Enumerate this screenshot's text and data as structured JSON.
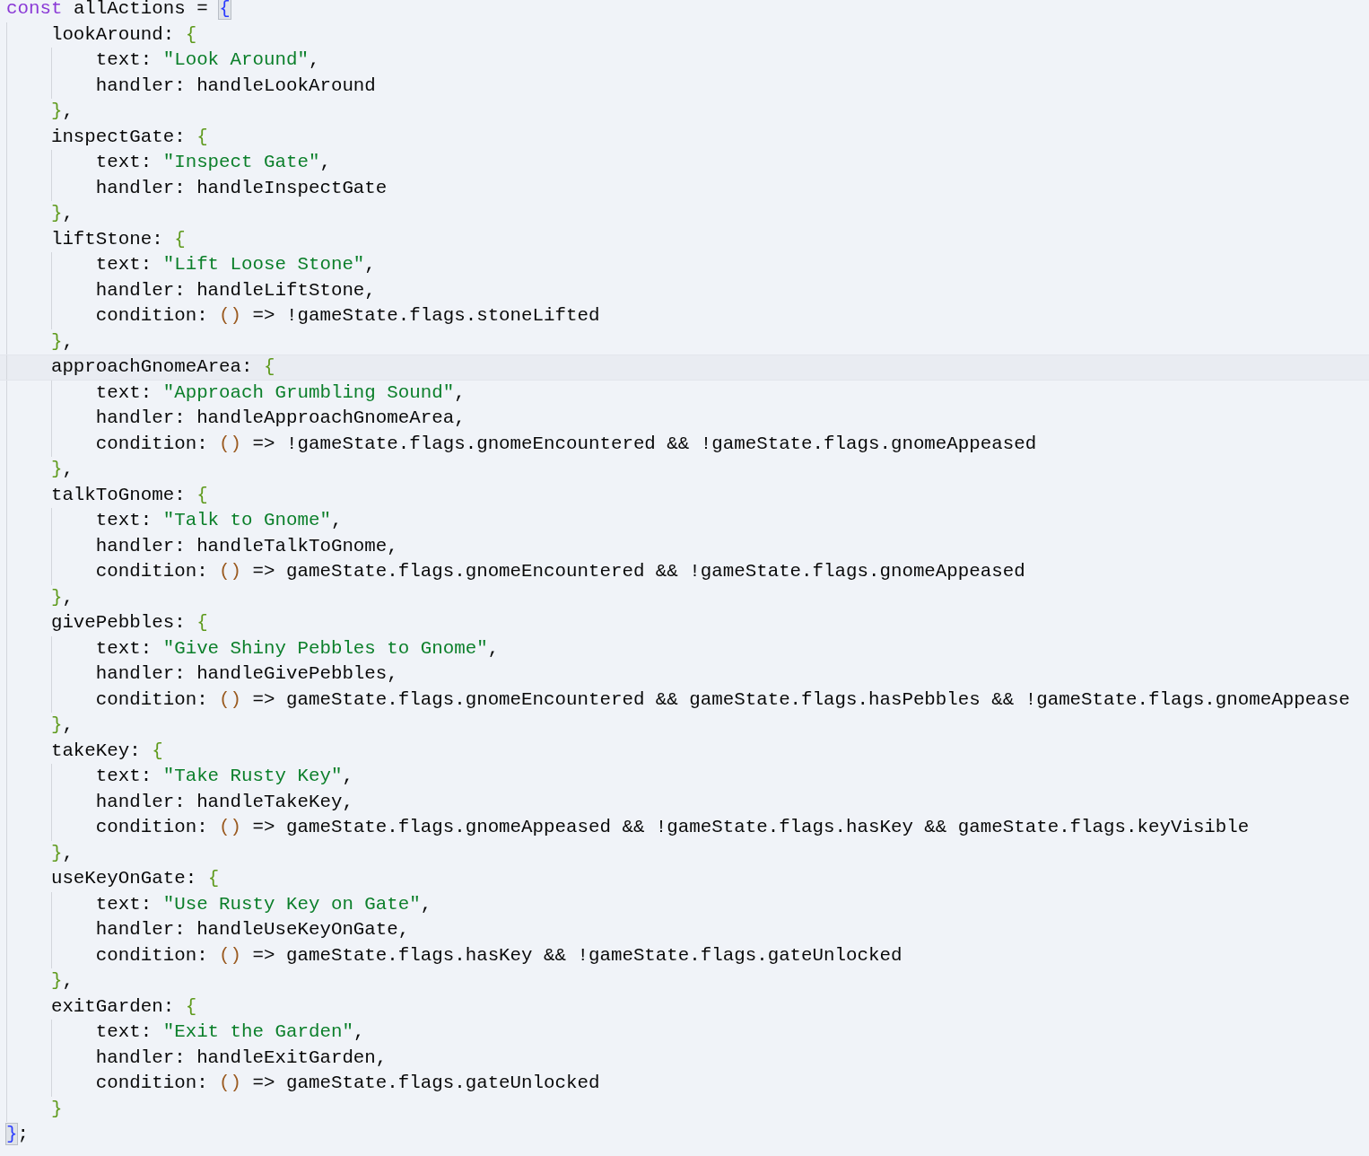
{
  "lines": [
    {
      "current": false,
      "tokens": [
        {
          "kind": "keyword",
          "text": "const"
        },
        {
          "kind": "plain",
          "text": " allActions = "
        },
        {
          "kind": "brace-match",
          "text": "{"
        }
      ],
      "children": [
        {
          "current": false,
          "tokens": [
            {
              "kind": "plain",
              "text": "lookAround: "
            },
            {
              "kind": "brace2",
              "text": "{"
            }
          ],
          "children": [
            {
              "current": false,
              "tokens": [
                {
                  "kind": "plain",
                  "text": "text: "
                },
                {
                  "kind": "string",
                  "text": "\"Look Around\""
                },
                {
                  "kind": "plain",
                  "text": ","
                }
              ]
            },
            {
              "current": false,
              "tokens": [
                {
                  "kind": "plain",
                  "text": "handler: handleLookAround"
                }
              ]
            }
          ]
        },
        {
          "current": false,
          "tokens": [
            {
              "kind": "brace2",
              "text": "}"
            },
            {
              "kind": "plain",
              "text": ","
            }
          ]
        },
        {
          "current": false,
          "tokens": [
            {
              "kind": "plain",
              "text": "inspectGate: "
            },
            {
              "kind": "brace2",
              "text": "{"
            }
          ],
          "children": [
            {
              "current": false,
              "tokens": [
                {
                  "kind": "plain",
                  "text": "text: "
                },
                {
                  "kind": "string",
                  "text": "\"Inspect Gate\""
                },
                {
                  "kind": "plain",
                  "text": ","
                }
              ]
            },
            {
              "current": false,
              "tokens": [
                {
                  "kind": "plain",
                  "text": "handler: handleInspectGate"
                }
              ]
            }
          ]
        },
        {
          "current": false,
          "tokens": [
            {
              "kind": "brace2",
              "text": "}"
            },
            {
              "kind": "plain",
              "text": ","
            }
          ]
        },
        {
          "current": false,
          "tokens": [
            {
              "kind": "plain",
              "text": "liftStone: "
            },
            {
              "kind": "brace2",
              "text": "{"
            }
          ],
          "children": [
            {
              "current": false,
              "tokens": [
                {
                  "kind": "plain",
                  "text": "text: "
                },
                {
                  "kind": "string",
                  "text": "\"Lift Loose Stone\""
                },
                {
                  "kind": "plain",
                  "text": ","
                }
              ]
            },
            {
              "current": false,
              "tokens": [
                {
                  "kind": "plain",
                  "text": "handler: handleLiftStone,"
                }
              ]
            },
            {
              "current": false,
              "tokens": [
                {
                  "kind": "plain",
                  "text": "condition: "
                },
                {
                  "kind": "paren",
                  "text": "()"
                },
                {
                  "kind": "plain",
                  "text": " => !gameState.flags.stoneLifted"
                }
              ]
            }
          ]
        },
        {
          "current": false,
          "tokens": [
            {
              "kind": "brace2",
              "text": "}"
            },
            {
              "kind": "plain",
              "text": ","
            }
          ]
        },
        {
          "current": true,
          "tokens": [
            {
              "kind": "plain",
              "text": "approachGnomeArea: "
            },
            {
              "kind": "brace2",
              "text": "{"
            }
          ],
          "children": [
            {
              "current": false,
              "tokens": [
                {
                  "kind": "plain",
                  "text": "text: "
                },
                {
                  "kind": "string",
                  "text": "\"Approach Grumbling Sound\""
                },
                {
                  "kind": "plain",
                  "text": ","
                }
              ]
            },
            {
              "current": false,
              "tokens": [
                {
                  "kind": "plain",
                  "text": "handler: handleApproachGnomeArea,"
                }
              ]
            },
            {
              "current": false,
              "tokens": [
                {
                  "kind": "plain",
                  "text": "condition: "
                },
                {
                  "kind": "paren",
                  "text": "()"
                },
                {
                  "kind": "plain",
                  "text": " => !gameState.flags.gnomeEncountered && !gameState.flags.gnomeAppeased"
                }
              ]
            }
          ]
        },
        {
          "current": false,
          "tokens": [
            {
              "kind": "brace2",
              "text": "}"
            },
            {
              "kind": "plain",
              "text": ","
            }
          ]
        },
        {
          "current": false,
          "tokens": [
            {
              "kind": "plain",
              "text": "talkToGnome: "
            },
            {
              "kind": "brace2",
              "text": "{"
            }
          ],
          "children": [
            {
              "current": false,
              "tokens": [
                {
                  "kind": "plain",
                  "text": "text: "
                },
                {
                  "kind": "string",
                  "text": "\"Talk to Gnome\""
                },
                {
                  "kind": "plain",
                  "text": ","
                }
              ]
            },
            {
              "current": false,
              "tokens": [
                {
                  "kind": "plain",
                  "text": "handler: handleTalkToGnome,"
                }
              ]
            },
            {
              "current": false,
              "tokens": [
                {
                  "kind": "plain",
                  "text": "condition: "
                },
                {
                  "kind": "paren",
                  "text": "()"
                },
                {
                  "kind": "plain",
                  "text": " => gameState.flags.gnomeEncountered && !gameState.flags.gnomeAppeased"
                }
              ]
            }
          ]
        },
        {
          "current": false,
          "tokens": [
            {
              "kind": "brace2",
              "text": "}"
            },
            {
              "kind": "plain",
              "text": ","
            }
          ]
        },
        {
          "current": false,
          "tokens": [
            {
              "kind": "plain",
              "text": "givePebbles: "
            },
            {
              "kind": "brace2",
              "text": "{"
            }
          ],
          "children": [
            {
              "current": false,
              "tokens": [
                {
                  "kind": "plain",
                  "text": "text: "
                },
                {
                  "kind": "string",
                  "text": "\"Give Shiny Pebbles to Gnome\""
                },
                {
                  "kind": "plain",
                  "text": ","
                }
              ]
            },
            {
              "current": false,
              "tokens": [
                {
                  "kind": "plain",
                  "text": "handler: handleGivePebbles,"
                }
              ]
            },
            {
              "current": false,
              "tokens": [
                {
                  "kind": "plain",
                  "text": "condition: "
                },
                {
                  "kind": "paren",
                  "text": "()"
                },
                {
                  "kind": "plain",
                  "text": " => gameState.flags.gnomeEncountered && gameState.flags.hasPebbles && !gameState.flags.gnomeAppease"
                }
              ]
            }
          ]
        },
        {
          "current": false,
          "tokens": [
            {
              "kind": "brace2",
              "text": "}"
            },
            {
              "kind": "plain",
              "text": ","
            }
          ]
        },
        {
          "current": false,
          "tokens": [
            {
              "kind": "plain",
              "text": "takeKey: "
            },
            {
              "kind": "brace2",
              "text": "{"
            }
          ],
          "children": [
            {
              "current": false,
              "tokens": [
                {
                  "kind": "plain",
                  "text": "text: "
                },
                {
                  "kind": "string",
                  "text": "\"Take Rusty Key\""
                },
                {
                  "kind": "plain",
                  "text": ","
                }
              ]
            },
            {
              "current": false,
              "tokens": [
                {
                  "kind": "plain",
                  "text": "handler: handleTakeKey,"
                }
              ]
            },
            {
              "current": false,
              "tokens": [
                {
                  "kind": "plain",
                  "text": "condition: "
                },
                {
                  "kind": "paren",
                  "text": "()"
                },
                {
                  "kind": "plain",
                  "text": " => gameState.flags.gnomeAppeased && !gameState.flags.hasKey && gameState.flags.keyVisible"
                }
              ]
            }
          ]
        },
        {
          "current": false,
          "tokens": [
            {
              "kind": "brace2",
              "text": "}"
            },
            {
              "kind": "plain",
              "text": ","
            }
          ]
        },
        {
          "current": false,
          "tokens": [
            {
              "kind": "plain",
              "text": "useKeyOnGate: "
            },
            {
              "kind": "brace2",
              "text": "{"
            }
          ],
          "children": [
            {
              "current": false,
              "tokens": [
                {
                  "kind": "plain",
                  "text": "text: "
                },
                {
                  "kind": "string",
                  "text": "\"Use Rusty Key on Gate\""
                },
                {
                  "kind": "plain",
                  "text": ","
                }
              ]
            },
            {
              "current": false,
              "tokens": [
                {
                  "kind": "plain",
                  "text": "handler: handleUseKeyOnGate,"
                }
              ]
            },
            {
              "current": false,
              "tokens": [
                {
                  "kind": "plain",
                  "text": "condition: "
                },
                {
                  "kind": "paren",
                  "text": "()"
                },
                {
                  "kind": "plain",
                  "text": " => gameState.flags.hasKey && !gameState.flags.gateUnlocked"
                }
              ]
            }
          ]
        },
        {
          "current": false,
          "tokens": [
            {
              "kind": "brace2",
              "text": "}"
            },
            {
              "kind": "plain",
              "text": ","
            }
          ]
        },
        {
          "current": false,
          "tokens": [
            {
              "kind": "plain",
              "text": "exitGarden: "
            },
            {
              "kind": "brace2",
              "text": "{"
            }
          ],
          "children": [
            {
              "current": false,
              "tokens": [
                {
                  "kind": "plain",
                  "text": "text: "
                },
                {
                  "kind": "string",
                  "text": "\"Exit the Garden\""
                },
                {
                  "kind": "plain",
                  "text": ","
                }
              ]
            },
            {
              "current": false,
              "tokens": [
                {
                  "kind": "plain",
                  "text": "handler: handleExitGarden,"
                }
              ]
            },
            {
              "current": false,
              "tokens": [
                {
                  "kind": "plain",
                  "text": "condition: "
                },
                {
                  "kind": "paren",
                  "text": "()"
                },
                {
                  "kind": "plain",
                  "text": " => gameState.flags.gateUnlocked"
                }
              ]
            }
          ]
        },
        {
          "current": false,
          "tokens": [
            {
              "kind": "brace2",
              "text": "}"
            }
          ]
        }
      ]
    },
    {
      "current": false,
      "tokens": [
        {
          "kind": "brace-match",
          "text": "}"
        },
        {
          "kind": "plain",
          "text": ";"
        }
      ]
    }
  ]
}
